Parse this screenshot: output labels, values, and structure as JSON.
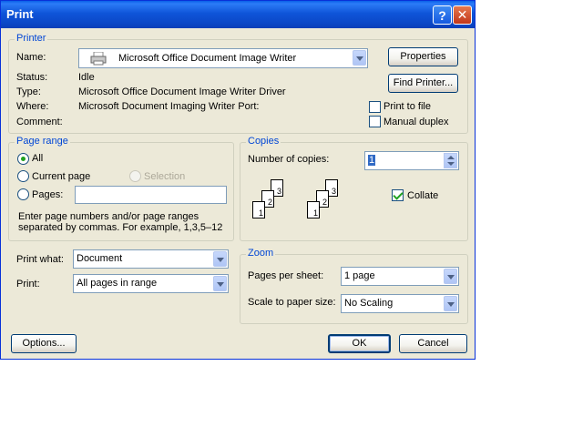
{
  "window": {
    "title": "Print"
  },
  "printer": {
    "legend": "Printer",
    "name_label": "Name:",
    "name_value": "Microsoft Office Document Image Writer",
    "status_label": "Status:",
    "status_value": "Idle",
    "type_label": "Type:",
    "type_value": "Microsoft Office Document Image Writer Driver",
    "where_label": "Where:",
    "where_value": "Microsoft Document Imaging Writer Port:",
    "comment_label": "Comment:",
    "comment_value": "",
    "properties_button": "Properties",
    "find_printer_button": "Find Printer...",
    "print_to_file": {
      "label": "Print to file",
      "checked": false
    },
    "manual_duplex": {
      "label": "Manual duplex",
      "checked": false
    }
  },
  "page_range": {
    "legend": "Page range",
    "all_label": "All",
    "current_page_label": "Current page",
    "selection_label": "Selection",
    "pages_label": "Pages:",
    "pages_value": "",
    "help_line1": "Enter page numbers and/or page ranges",
    "help_line2": "separated by commas.  For example, 1,3,5–12",
    "selected": "All"
  },
  "copies": {
    "legend": "Copies",
    "number_label": "Number of copies:",
    "number_value": "1",
    "collate": {
      "label": "Collate",
      "checked": true
    },
    "page_numbers": [
      "3",
      "2",
      "1"
    ]
  },
  "print_what": {
    "label": "Print what:",
    "value": "Document"
  },
  "print": {
    "label": "Print:",
    "value": "All pages in range"
  },
  "zoom": {
    "legend": "Zoom",
    "pages_per_sheet_label": "Pages per sheet:",
    "pages_per_sheet_value": "1 page",
    "scale_label": "Scale to paper size:",
    "scale_value": "No Scaling"
  },
  "footer": {
    "options_button": "Options...",
    "ok_button": "OK",
    "cancel_button": "Cancel"
  }
}
